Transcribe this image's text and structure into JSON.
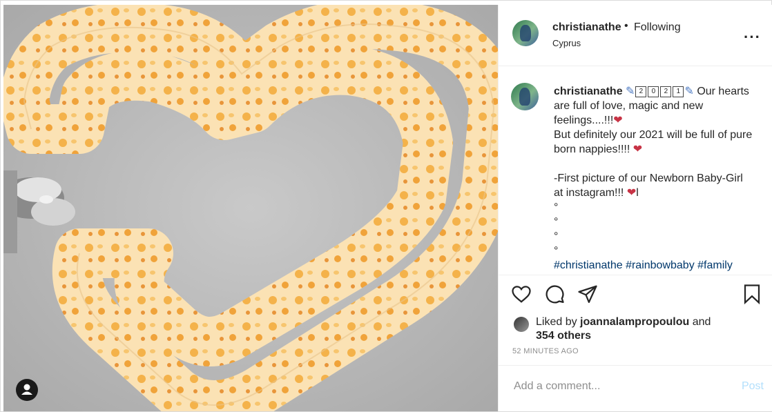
{
  "header": {
    "username": "christianathe",
    "separator": "•",
    "follow_status": "Following",
    "location": "Cyprus",
    "more_icon": "more-horizontal-icon"
  },
  "caption": {
    "username": "christianathe",
    "year_digits": [
      "2",
      "0",
      "2",
      "1"
    ],
    "line1": "Our hearts are full of love, magic and new feelings....!!!",
    "line2": "But definitely our 2021 will be full of pure born nappies!!!!",
    "line3": "-First picture of our Newborn Baby-Girl at instagram!!!",
    "line3_suffix": "l",
    "bullets": [
      "°",
      "°",
      "°",
      "°"
    ],
    "hashtags": "#christianathe #rainbowbaby #family"
  },
  "actions": {
    "like_icon": "heart-icon",
    "comment_icon": "comment-icon",
    "share_icon": "share-icon",
    "save_icon": "bookmark-icon"
  },
  "likes": {
    "prefix": "Liked by",
    "user": "joannalampropoulou",
    "conjunction": "and",
    "others": "354 others"
  },
  "timestamp": "52 MINUTES AGO",
  "comment": {
    "placeholder": "Add a comment...",
    "post_label": "Post"
  },
  "colors": {
    "link": "#00376b",
    "post_disabled": "#b2dffc",
    "muted": "#8e8e8e",
    "heart": "#c73345"
  },
  "photo": {
    "user_tag_icon": "user-tag-icon"
  }
}
